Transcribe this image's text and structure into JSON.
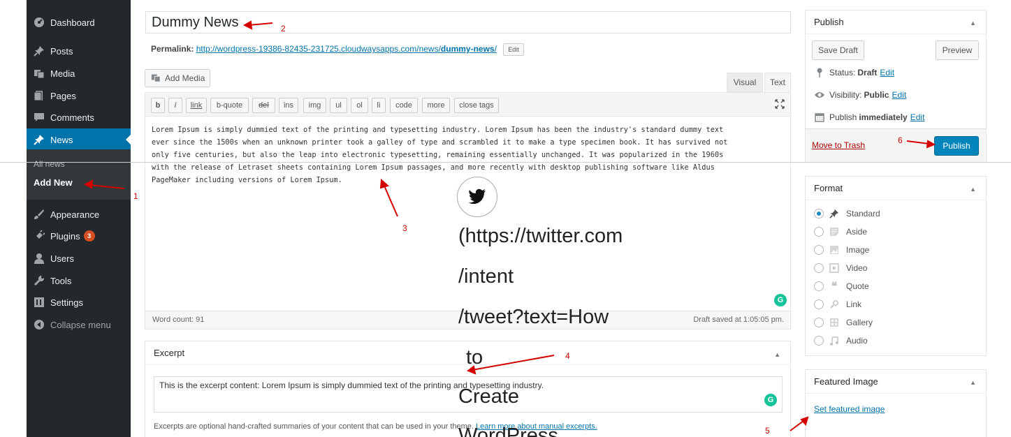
{
  "sidebar": {
    "items": [
      {
        "label": "Dashboard",
        "icon": "dashboard-icon"
      },
      {
        "label": "Posts",
        "icon": "pin-icon"
      },
      {
        "label": "Media",
        "icon": "media-icon"
      },
      {
        "label": "Pages",
        "icon": "pages-icon"
      },
      {
        "label": "Comments",
        "icon": "comments-icon"
      },
      {
        "label": "News",
        "icon": "pin-icon"
      },
      {
        "label": "Appearance",
        "icon": "appearance-icon"
      },
      {
        "label": "Plugins",
        "icon": "plugins-icon",
        "badge": "3"
      },
      {
        "label": "Users",
        "icon": "users-icon"
      },
      {
        "label": "Tools",
        "icon": "tools-icon"
      },
      {
        "label": "Settings",
        "icon": "settings-icon"
      },
      {
        "label": "Collapse menu",
        "icon": "collapse-icon"
      }
    ],
    "submenu": [
      "All news",
      "Add New"
    ]
  },
  "editor": {
    "title": "Dummy News",
    "permalink_label": "Permalink:",
    "permalink_url": "http://wordpress-19386-82435-231725.cloudwaysapps.com/news/",
    "permalink_slug": "dummy-news",
    "permalink_tail": "/",
    "permalink_edit": "Edit",
    "add_media": "Add Media",
    "tab_visual": "Visual",
    "tab_text": "Text",
    "quicktags": [
      "b",
      "i",
      "link",
      "b-quote",
      "del",
      "ins",
      "img",
      "ul",
      "ol",
      "li",
      "code",
      "more",
      "close tags"
    ],
    "content": "Lorem Ipsum is simply dummied text of the printing and typesetting industry. Lorem Ipsum has been the industry's standard dummy text\never since the 1500s when an unknown printer took a galley of type and scrambled it to make a type specimen book. It has survived not\nonly five centuries, but also the leap into electronic typesetting, remaining essentially unchanged. It was popularized in the 1960s\nwith the release of Letraset sheets containing Lorem Ipsum passages, and more recently with desktop publishing software like Aldus\nPageMaker including versions of Lorem Ipsum.",
    "word_count": "Word count: 91",
    "draft_saved": "Draft saved at 1:05:05 pm."
  },
  "excerpt": {
    "heading": "Excerpt",
    "content": "This is the excerpt content: Lorem Ipsum is simply dummied text of the printing and typesetting industry.",
    "help_text": "Excerpts are optional hand-crafted summaries of your content that can be used in your theme.",
    "help_link": "Learn more about manual excerpts."
  },
  "publish": {
    "heading": "Publish",
    "save_draft": "Save Draft",
    "preview": "Preview",
    "status_label": "Status:",
    "status_value": "Draft",
    "visibility_label": "Visibility:",
    "visibility_value": "Public",
    "publish_label": "Publish",
    "publish_value": "immediately",
    "edit": "Edit",
    "move_to_trash": "Move to Trash",
    "publish_button": "Publish"
  },
  "format": {
    "heading": "Format",
    "options": [
      {
        "label": "Standard",
        "icon": "pin-icon",
        "checked": true
      },
      {
        "label": "Aside",
        "icon": "aside-icon",
        "checked": false
      },
      {
        "label": "Image",
        "icon": "image-icon",
        "checked": false
      },
      {
        "label": "Video",
        "icon": "video-icon",
        "checked": false
      },
      {
        "label": "Quote",
        "icon": "quote-icon",
        "checked": false
      },
      {
        "label": "Link",
        "icon": "link-icon",
        "checked": false
      },
      {
        "label": "Gallery",
        "icon": "gallery-icon",
        "checked": false
      },
      {
        "label": "Audio",
        "icon": "audio-icon",
        "checked": false
      }
    ]
  },
  "featured_image": {
    "heading": "Featured Image",
    "set_link": "Set featured image"
  },
  "annotations": [
    "1",
    "2",
    "3",
    "4",
    "5",
    "6"
  ],
  "tweet_overlay": {
    "lines": [
      "(https://twitter.com",
      "/intent",
      "/tweet?text=How",
      "to",
      "Create",
      "WordPress"
    ]
  },
  "colors": {
    "sidebar_bg": "#23282d",
    "active_blue": "#0073aa",
    "publish_blue": "#0085ba",
    "annotation_red": "#d40000",
    "trash_red": "#aa0000"
  }
}
